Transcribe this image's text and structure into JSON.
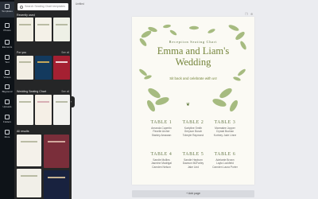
{
  "rail": {
    "items": [
      {
        "label": "Templates",
        "active": true
      },
      {
        "label": "Photos"
      },
      {
        "label": "Elements"
      },
      {
        "label": "Text"
      },
      {
        "label": "Videos"
      },
      {
        "label": "Bkground"
      },
      {
        "label": "Uploads"
      },
      {
        "label": "Folders"
      },
      {
        "label": "More"
      }
    ]
  },
  "panel": {
    "search_placeholder": "Search Seating Chart templates",
    "sections": [
      {
        "title": "Recently used",
        "see_all": ""
      },
      {
        "title": "For you",
        "see_all": "See all"
      },
      {
        "title": "Wedding Seating Chart",
        "see_all": "See all"
      },
      {
        "title": "All results",
        "see_all": ""
      }
    ]
  },
  "workspace": {
    "page_label": "Untitled",
    "add_page": "+ Add page",
    "collapse_glyph": "‹"
  },
  "design": {
    "kicker": "Reception Seating Chart",
    "title_line1": "Emma and Liam's",
    "title_line2": "Wedding",
    "subtitle": "Sit back and celebrate with us!",
    "divider": "❦",
    "tables": [
      {
        "name": "TABLE 1",
        "guests": [
          "Amanda Cupertin",
          "Pavelie Archer",
          "Stanley Amawan"
        ]
      },
      {
        "name": "TABLE 2",
        "guests": [
          "Kartyline Smith",
          "Greyson Bosch",
          "Tobeyle Raymond"
        ]
      },
      {
        "name": "TABLE 3",
        "guests": [
          "Marmalee Jopper",
          "Crystal Buchan",
          "Kortney Jude Linne"
        ]
      },
      {
        "name": "TABLE 4",
        "guests": [
          "Sandie Mullins",
          "Jasmine Madrigal",
          "Camden Nelson"
        ]
      },
      {
        "name": "TABLE 5",
        "guests": [
          "Sandie Hepburn",
          "Dawson McFarley",
          "Jake Lind"
        ]
      },
      {
        "name": "TABLE 6",
        "guests": [
          "Adelante Brown",
          "Layla Lockfield",
          "Camden Laura Porter"
        ]
      }
    ]
  },
  "colors": {
    "rail": "#0e1318",
    "panel": "#252627",
    "workspace": "#ebecf0",
    "heading_green": "#74843a",
    "leaf_green": "#7f9a4f"
  }
}
